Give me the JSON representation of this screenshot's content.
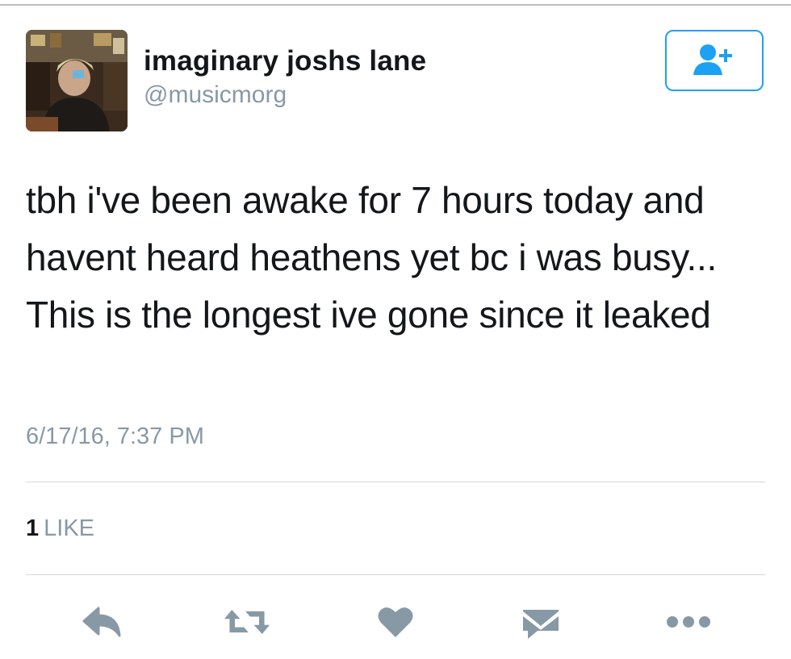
{
  "user": {
    "display_name": "imaginary joshs lane",
    "handle": "@musicmorg",
    "avatar_icon": "profile-photo"
  },
  "follow_button": {
    "icon": "follow-user-icon",
    "color": "#1da1f2"
  },
  "tweet": {
    "text": "tbh i've been awake for 7 hours today and havent heard heathens yet bc i was busy... This is the longest ive gone since it leaked",
    "timestamp": "6/17/16, 7:37 PM"
  },
  "stats": {
    "like_count": "1",
    "like_label": "LIKE"
  },
  "actions": [
    {
      "icon": "reply-icon"
    },
    {
      "icon": "retweet-icon"
    },
    {
      "icon": "heart-icon"
    },
    {
      "icon": "direct-message-icon"
    },
    {
      "icon": "more-icon"
    }
  ],
  "colors": {
    "text": "#14171a",
    "secondary": "#8899a6",
    "action_icons": "#8899a6",
    "accent": "#1da1f2"
  }
}
